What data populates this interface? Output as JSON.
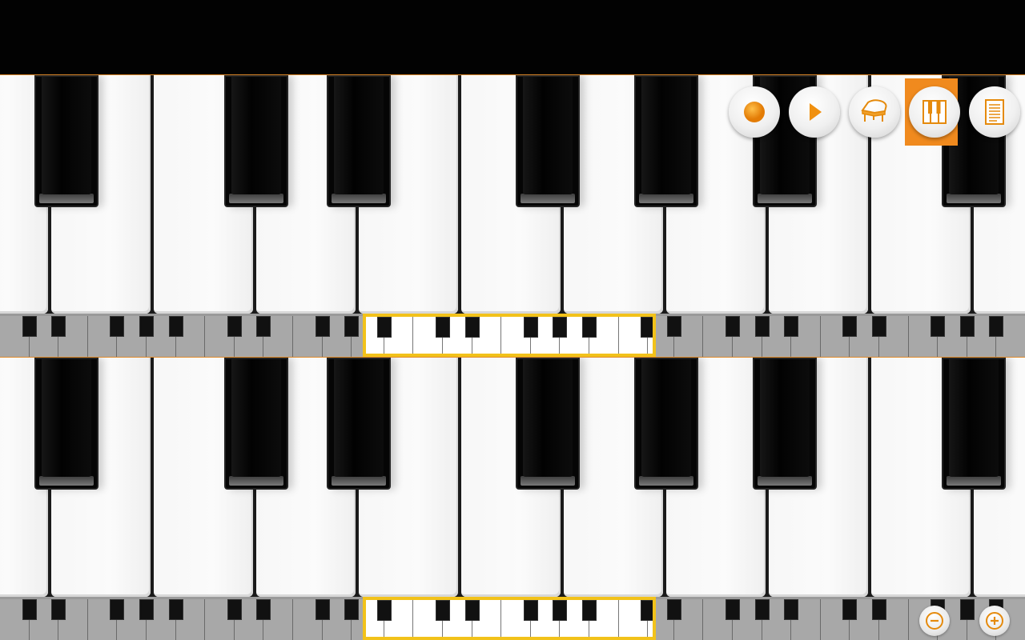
{
  "colors": {
    "accent": "#f39c12",
    "viewport_border": "#f2c21a",
    "toolbar_selected": "#f08a1e"
  },
  "toolbar": {
    "buttons": [
      {
        "name": "record",
        "icon": "record-icon"
      },
      {
        "name": "play",
        "icon": "play-icon"
      },
      {
        "name": "instrument",
        "icon": "grand-piano-icon"
      },
      {
        "name": "keyboard-layout",
        "icon": "piano-keys-icon",
        "selected": true
      },
      {
        "name": "sheet",
        "icon": "document-icon"
      }
    ]
  },
  "keyboards": [
    {
      "name": "upper-keyboard"
    },
    {
      "name": "lower-keyboard"
    }
  ],
  "zoom": {
    "out_icon": "zoom-out-icon",
    "in_icon": "zoom-in-icon"
  }
}
